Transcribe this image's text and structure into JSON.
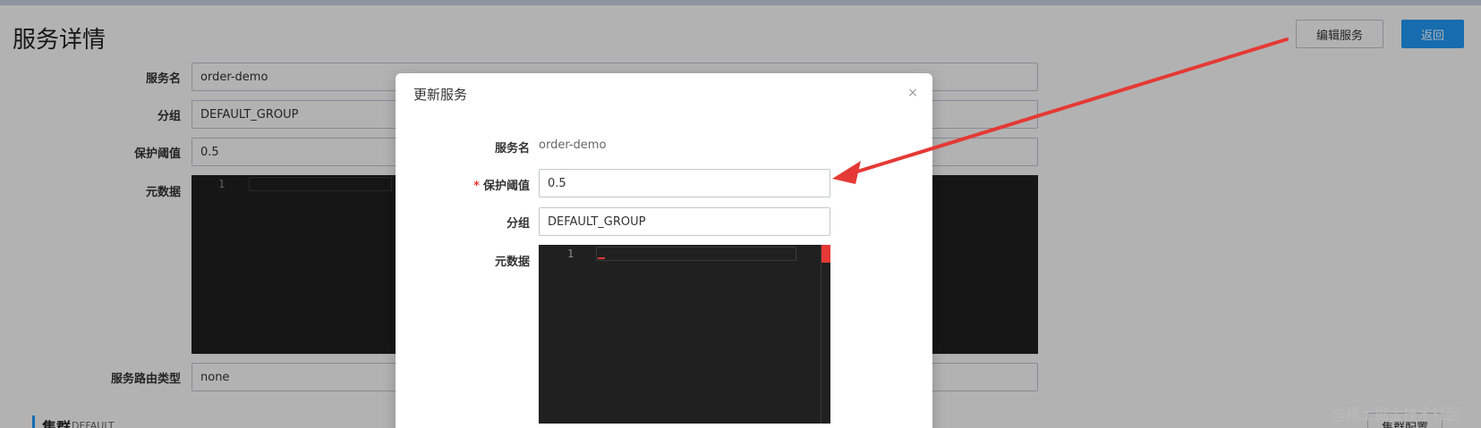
{
  "page": {
    "title": "服务详情",
    "edit_button": "编辑服务",
    "back_button": "返回",
    "fields": {
      "service_name_label": "服务名",
      "service_name_value": "order-demo",
      "group_label": "分组",
      "group_value": "DEFAULT_GROUP",
      "threshold_label": "保护阈值",
      "threshold_value": "0.5",
      "metadata_label": "元数据",
      "metadata_line": "1",
      "route_type_label": "服务路由类型",
      "route_type_value": "none"
    },
    "cluster": {
      "title": "集群",
      "name": "DEFAULT",
      "config_button": "集群配置"
    }
  },
  "dialog": {
    "title": "更新服务",
    "close_icon": "×",
    "service_name_label": "服务名",
    "service_name_value": "order-demo",
    "threshold_required": "*",
    "threshold_label": "保护阈值",
    "threshold_value": "0.5",
    "group_label": "分组",
    "group_value": "DEFAULT_GROUP",
    "metadata_label": "元数据",
    "metadata_line": "1"
  },
  "watermark": "@稀土掘金技术社区",
  "colors": {
    "primary": "#209bfa",
    "editor_bg": "#202020",
    "annotation_arrow": "#e53935",
    "required_mark": "#e53935"
  }
}
